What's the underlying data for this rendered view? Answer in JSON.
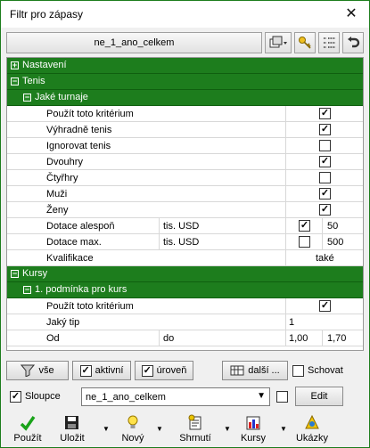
{
  "window": {
    "title": "Filtr pro zápasy",
    "close_glyph": "✕"
  },
  "filterbar": {
    "name": "ne_1_ano_celkem"
  },
  "sections": {
    "nastaveni": "Nastavení",
    "tenis": "Tenis",
    "jake_turnaje": "Jaké turnaje",
    "kursy": "Kursy",
    "podminka": "1. podmínka pro kurs"
  },
  "tenis_rows": [
    {
      "label": "Použít toto kritérium",
      "checked": true
    },
    {
      "label": "Výhradně tenis",
      "checked": true
    },
    {
      "label": "Ignorovat tenis",
      "checked": false
    },
    {
      "label": "Dvouhry",
      "checked": true
    },
    {
      "label": "Čtyřhry",
      "checked": false
    },
    {
      "label": "Muži",
      "checked": true
    },
    {
      "label": "Ženy",
      "checked": true
    }
  ],
  "dotace_alespon": {
    "label": "Dotace alespoň",
    "unit": "tis. USD",
    "checked": true,
    "value": "50"
  },
  "dotace_max": {
    "label": "Dotace max.",
    "unit": "tis. USD",
    "checked": false,
    "value": "500"
  },
  "kvalifikace": {
    "label": "Kvalifikace",
    "value": "také"
  },
  "kursy_rows": {
    "pouzit": {
      "label": "Použít toto kritérium",
      "checked": true
    },
    "jaky_tip": {
      "label": "Jaký tip",
      "value": "1"
    },
    "od": {
      "label": "Od",
      "unit": "do",
      "from": "1,00",
      "to": "1,70"
    }
  },
  "toolbar": {
    "vse": "vše",
    "aktivni": "aktivní",
    "uroven": "úroveň",
    "dalsi": "další ...",
    "schovat": "Schovat"
  },
  "sloupce": {
    "label": "Sloupce",
    "checked": true,
    "value": "ne_1_ano_celkem",
    "edit": "Edit"
  },
  "footer": {
    "pouzit": "Použít",
    "ulozit": "Uložit",
    "novy": "Nový",
    "shrnuti": "Shrnutí",
    "kursy": "Kursy",
    "ukazky": "Ukázky"
  },
  "colors": {
    "accent": "#1d7d1d",
    "check": "#000000"
  }
}
